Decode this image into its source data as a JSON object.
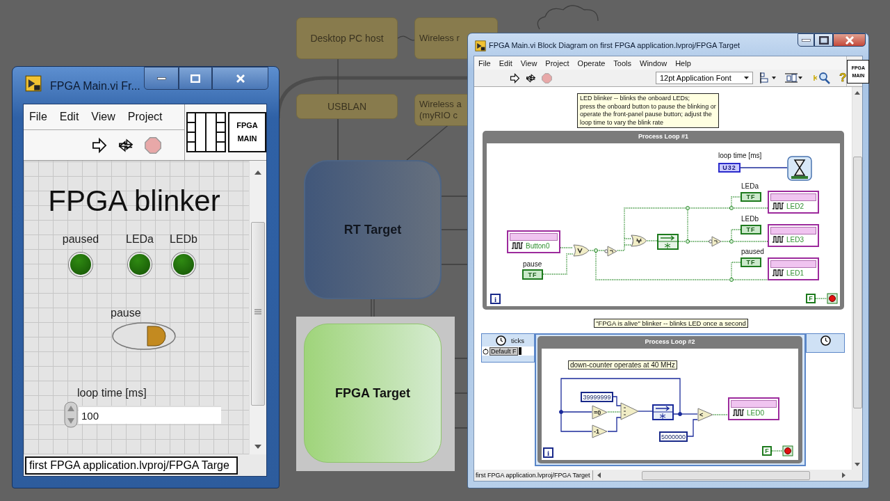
{
  "background_diagram": {
    "boxes": [
      {
        "kind": "link",
        "lines": [
          "Desktop PC host"
        ]
      },
      {
        "kind": "link",
        "lines": [
          "Wireless r"
        ]
      },
      {
        "kind": "link",
        "lines": [
          "USBLAN"
        ]
      },
      {
        "kind": "link",
        "lines": [
          "Wireless a",
          "(myRIO c"
        ]
      },
      {
        "kind": "rt",
        "lines": [
          "RT Target"
        ]
      },
      {
        "kind": "fpga",
        "lines": [
          "FPGA Target"
        ]
      }
    ]
  },
  "front_panel": {
    "window": {
      "title": "FPGA Main.vi Fr..."
    },
    "menu": [
      "File",
      "Edit",
      "View",
      "Project"
    ],
    "vi_icon": [
      "FPGA",
      "MAIN"
    ],
    "heading": "FPGA blinker",
    "leds": [
      {
        "label": "paused",
        "on": false
      },
      {
        "label": "LEDa",
        "on": false
      },
      {
        "label": "LEDb",
        "on": false
      }
    ],
    "pause_switch": {
      "label": "pause",
      "on": false
    },
    "loop_time": {
      "label": "loop time [ms]",
      "value": "100"
    },
    "status_bar": "first FPGA application.lvproj/FPGA Targe"
  },
  "block_diagram": {
    "window": {
      "title": "FPGA Main.vi Block Diagram on first FPGA application.lvproj/FPGA Target"
    },
    "menu": [
      "File",
      "Edit",
      "View",
      "Project",
      "Operate",
      "Tools",
      "Window",
      "Help"
    ],
    "font_dropdown": "12pt Application Font",
    "help_glyph": "?",
    "vi_icon": [
      "FPGA",
      "MAIN"
    ],
    "comment": "LED blinker -- blinks the onboard LEDs;\npress the onboard button to pause the blinking or\noperate the front-panel pause button; adjust the\nloop time to vary the blink rate",
    "loop_1": {
      "title": "Process Loop #1",
      "items": [
        {
          "kind": "label",
          "text": "loop time [ms]"
        },
        {
          "kind": "control",
          "text": "U32"
        },
        {
          "kind": "label",
          "text": "LEDa"
        },
        {
          "kind": "indicator",
          "text": "TF"
        },
        {
          "kind": "io",
          "text": "LED2"
        },
        {
          "kind": "label",
          "text": "LEDb"
        },
        {
          "kind": "indicator",
          "text": "TF"
        },
        {
          "kind": "io",
          "text": "LED3"
        },
        {
          "kind": "label",
          "text": "paused"
        },
        {
          "kind": "indicator",
          "text": "TF"
        },
        {
          "kind": "io",
          "text": "LED1"
        },
        {
          "kind": "io",
          "text": "Button0"
        },
        {
          "kind": "label",
          "text": "pause"
        },
        {
          "kind": "bool_control",
          "text": "TF"
        },
        {
          "kind": "iteration",
          "text": "i"
        },
        {
          "kind": "bool_constant",
          "text": "F"
        }
      ]
    },
    "comment_2": "\"FPGA is alive\" blinker -- blinks LED once a second",
    "timed_loop": {
      "source_label": "ticks",
      "source_name": "Default F"
    },
    "loop_2": {
      "title": "Process Loop #2",
      "items": [
        {
          "kind": "comment",
          "text": "down-counter operates at 40 MHz"
        },
        {
          "kind": "number_constant",
          "text": "39999999"
        },
        {
          "kind": "primitive",
          "text": "=0"
        },
        {
          "kind": "primitive",
          "text": "-1"
        },
        {
          "kind": "primitive",
          "text": "<"
        },
        {
          "kind": "number_constant",
          "text": "5000000"
        },
        {
          "kind": "io",
          "text": "LED0"
        },
        {
          "kind": "iteration",
          "text": "i"
        },
        {
          "kind": "bool_constant",
          "text": "F"
        }
      ]
    },
    "status_bar": "first FPGA application.lvproj/FPGA Target"
  }
}
